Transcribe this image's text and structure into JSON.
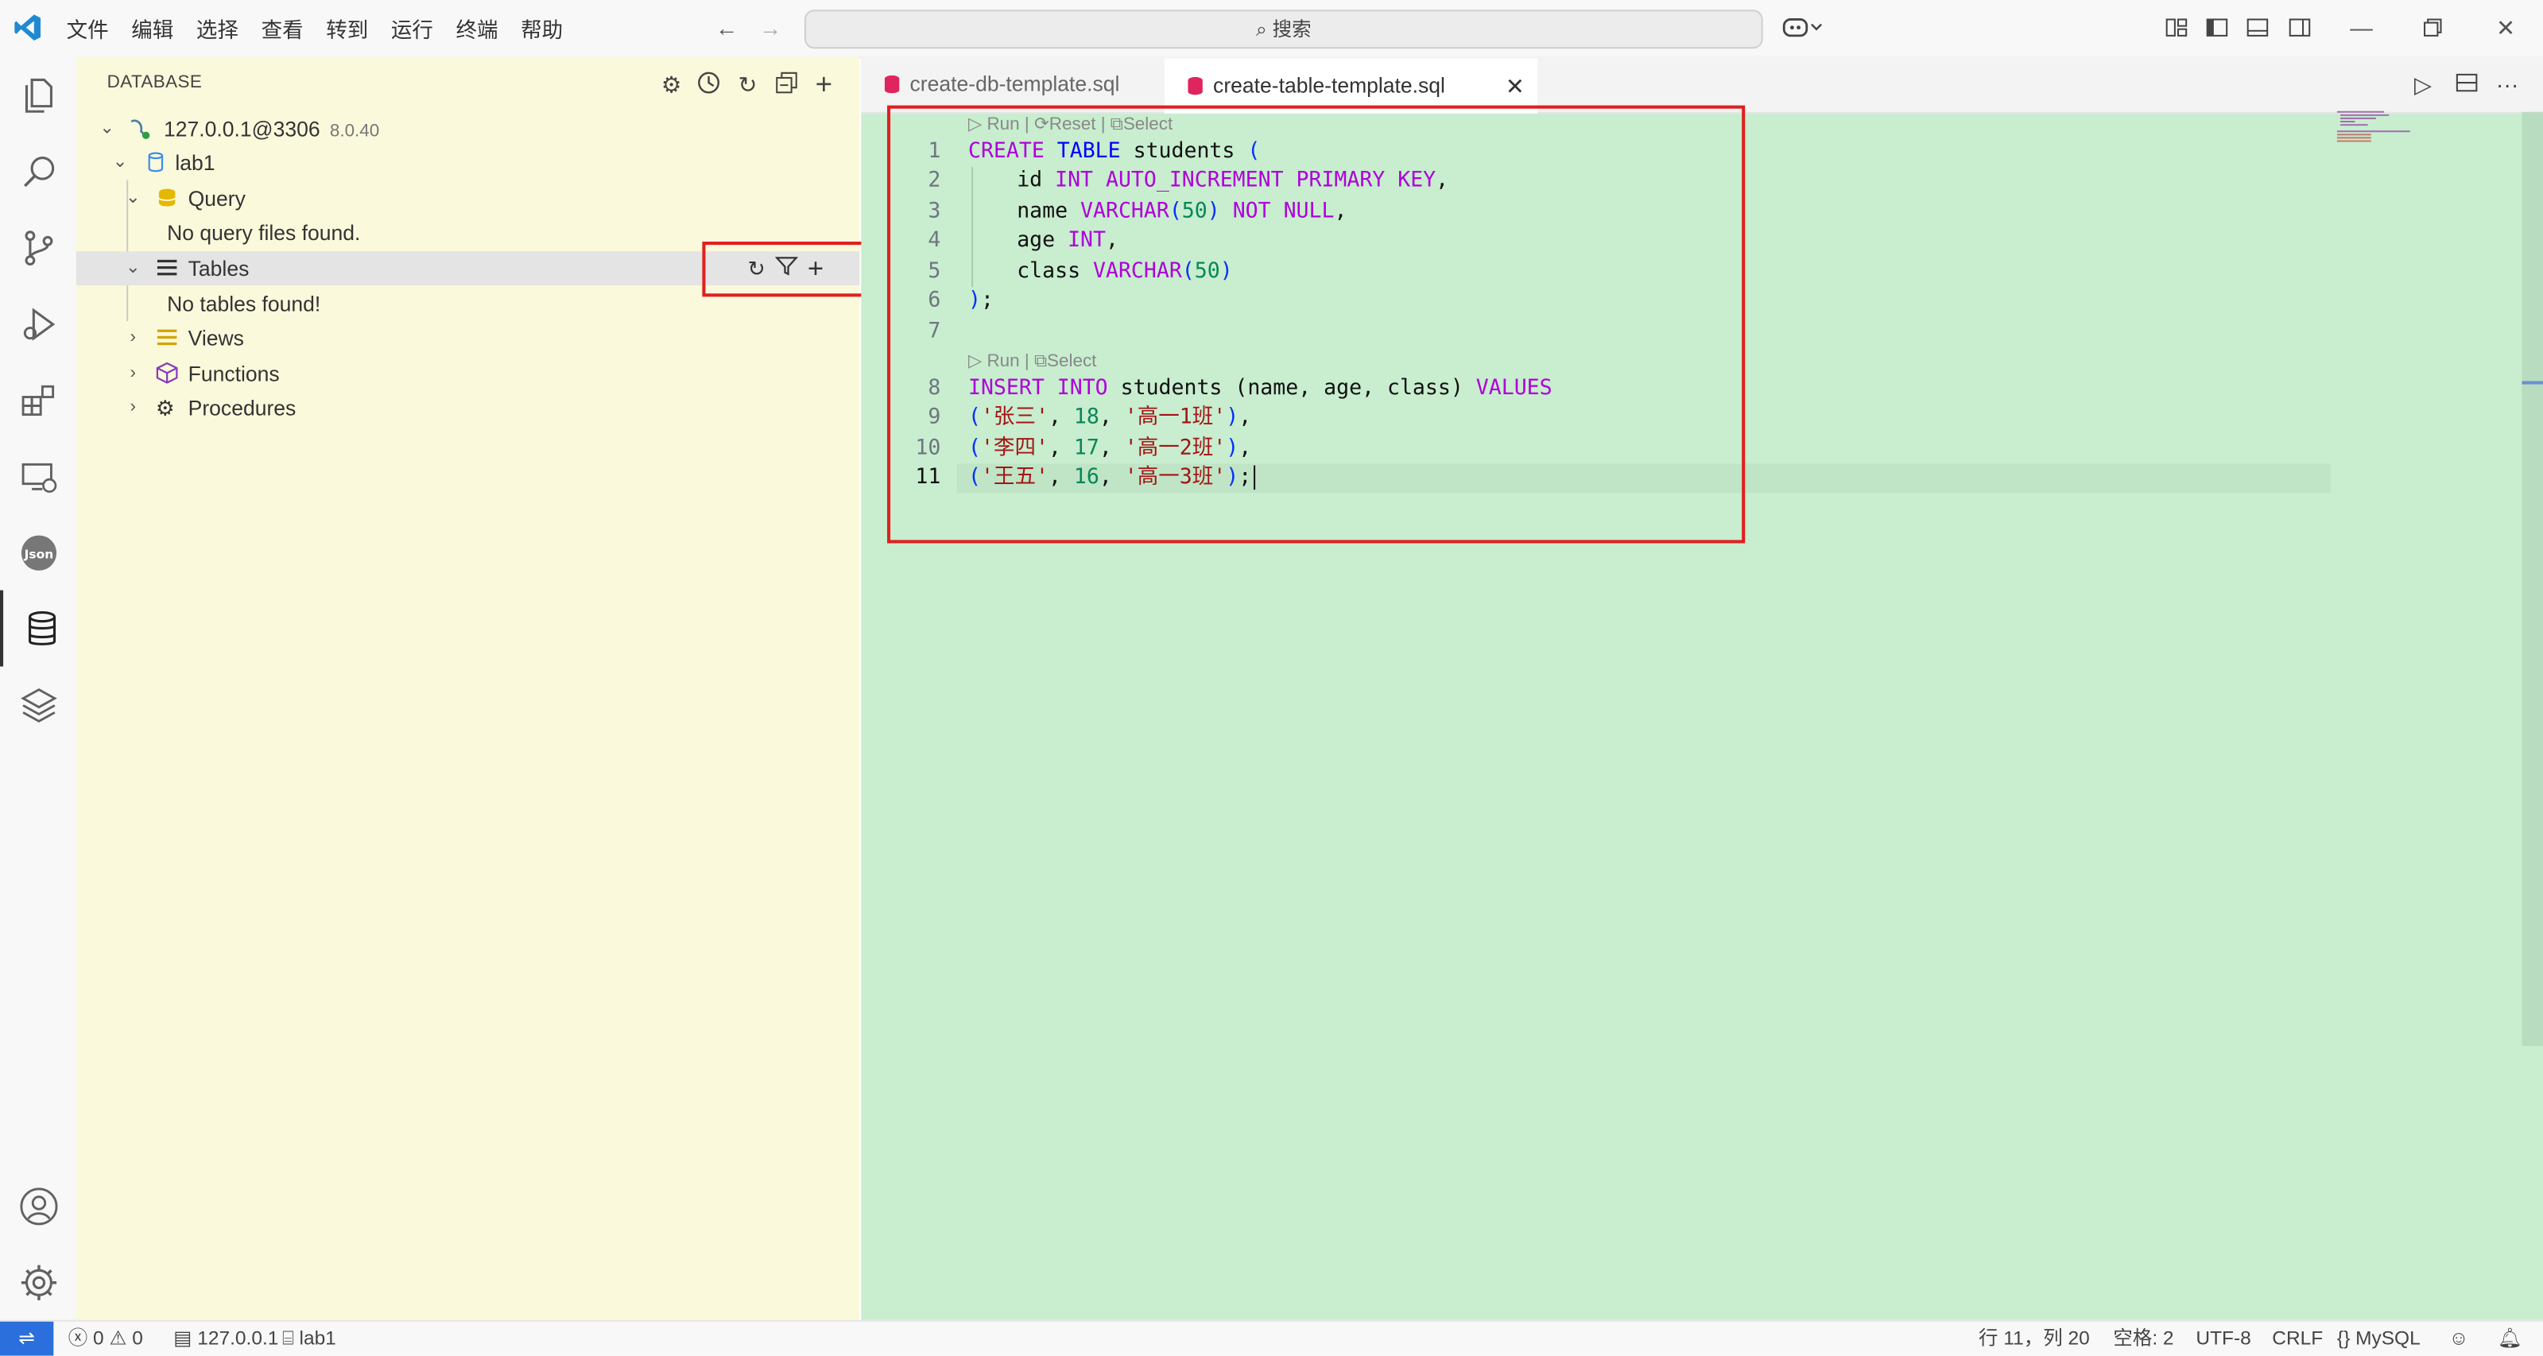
{
  "menu": [
    "文件",
    "编辑",
    "选择",
    "查看",
    "转到",
    "运行",
    "终端",
    "帮助"
  ],
  "search": {
    "label": "搜索"
  },
  "sidebar": {
    "title": "DATABASE",
    "connection": {
      "name": "127.0.0.1@3306",
      "version": "8.0.40"
    },
    "database": "lab1",
    "query": {
      "label": "Query",
      "empty": "No query files found."
    },
    "tables": {
      "label": "Tables",
      "empty": "No tables found!"
    },
    "views": "Views",
    "functions": "Functions",
    "procedures": "Procedures"
  },
  "tabs": [
    {
      "label": "create-db-template.sql",
      "active": false
    },
    {
      "label": "create-table-template.sql",
      "active": true
    }
  ],
  "codelens1": {
    "run": "Run",
    "reset": "Reset",
    "select": "Select",
    "sep": "|"
  },
  "codelens2": {
    "run": "Run",
    "select": "Select",
    "sep": "|"
  },
  "code": {
    "lines": [
      "1",
      "2",
      "3",
      "4",
      "5",
      "6",
      "7",
      "8",
      "9",
      "10",
      "11"
    ],
    "l1": {
      "kw1": "CREATE",
      "kw2": "TABLE",
      "name": "students",
      "paren": "("
    },
    "l2": {
      "col": "id",
      "type": "INT",
      "rest": "AUTO_INCREMENT PRIMARY KEY",
      "comma": ","
    },
    "l3": {
      "col": "name",
      "type": "VARCHAR",
      "open": "(",
      "num": "50",
      "close": ")",
      "rest": "NOT NULL",
      "comma": ","
    },
    "l4": {
      "col": "age",
      "type": "INT",
      "comma": ","
    },
    "l5": {
      "col": "class",
      "type": "VARCHAR",
      "open": "(",
      "num": "50",
      "close": ")"
    },
    "l6": {
      "close": ")",
      "semi": ";"
    },
    "l8": {
      "kw1": "INSERT",
      "kw2": "INTO",
      "name": "students",
      "cols": "(name, age, class)",
      "kw3": "VALUES"
    },
    "l9": {
      "s1": "'张三'",
      "n": "18",
      "s2": "'高一1班'"
    },
    "l10": {
      "s1": "'李四'",
      "n": "17",
      "s2": "'高一2班'"
    },
    "l11": {
      "s1": "'王五'",
      "n": "16",
      "s2": "'高一3班'"
    }
  },
  "status": {
    "errors": "0",
    "warnings": "0",
    "connection": "127.0.0.1",
    "database": "lab1",
    "position": "行 11，列 20",
    "spaces": "空格: 2",
    "encoding": "UTF-8",
    "eol": "CRLF",
    "language": "MySQL"
  }
}
